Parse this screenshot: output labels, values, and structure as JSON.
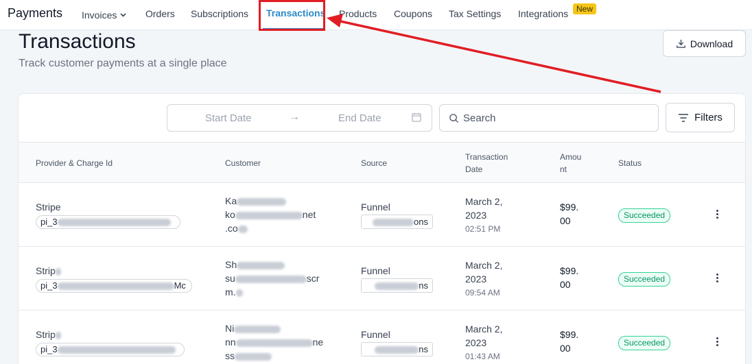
{
  "nav": {
    "brand": "Payments",
    "items": [
      {
        "label": "Invoices"
      },
      {
        "label": "Orders"
      },
      {
        "label": "Subscriptions"
      },
      {
        "label": "Transactions"
      },
      {
        "label": "Products"
      },
      {
        "label": "Coupons"
      },
      {
        "label": "Tax Settings"
      },
      {
        "label": "Integrations"
      }
    ],
    "new_badge": "New",
    "active": "Transactions"
  },
  "page": {
    "title": "Transactions",
    "subtitle": "Track customer payments at a single place",
    "download_label": "Download"
  },
  "toolbar": {
    "start_date_placeholder": "Start Date",
    "end_date_placeholder": "End Date",
    "search_placeholder": "Search",
    "filters_label": "Filters"
  },
  "table": {
    "headers": {
      "provider": "Provider & Charge Id",
      "customer": "Customer",
      "source": "Source",
      "date_line1": "Transaction",
      "date_line2": "Date",
      "amount_line1": "Amou",
      "amount_line2": "nt",
      "status": "Status"
    },
    "rows": [
      {
        "provider": "Stripe",
        "charge_prefix": "pi_3",
        "charge_suffix": "",
        "customer_l1_prefix": "Ka",
        "customer_l2_prefix": "ko",
        "customer_l2_suffix": "net",
        "customer_l3_prefix": ".co",
        "source": "Funnel",
        "source_box_suffix": "ons",
        "date_l1": "March 2,",
        "date_l2": "2023",
        "time": "02:51 PM",
        "amount_l1": "$99.",
        "amount_l2": "00",
        "status": "Succeeded"
      },
      {
        "provider": "Strip",
        "charge_prefix": "pi_3",
        "charge_suffix": "Mc",
        "customer_l1_prefix": "Sh",
        "customer_l2_prefix": "su",
        "customer_l2_suffix": "scr",
        "customer_l3_prefix": "m.",
        "source": "Funnel",
        "source_box_suffix": "ns",
        "date_l1": "March 2,",
        "date_l2": "2023",
        "time": "09:54 AM",
        "amount_l1": "$99.",
        "amount_l2": "00",
        "status": "Succeeded"
      },
      {
        "provider": "Strip",
        "charge_prefix": "pi_3",
        "charge_suffix": "",
        "customer_l1_prefix": "Ni",
        "customer_l2_prefix": "nn",
        "customer_l2_suffix": "ne",
        "customer_l3_prefix": "ss",
        "source": "Funnel",
        "source_box_suffix": "ns",
        "date_l1": "March 2,",
        "date_l2": "2023",
        "time": "01:43 AM",
        "amount_l1": "$99.",
        "amount_l2": "00",
        "status": "Succeeded"
      }
    ]
  },
  "colors": {
    "accent": "#2b8ac6",
    "annotation_red": "#e11d24",
    "success": "#059669",
    "badge": "#f5c518"
  }
}
